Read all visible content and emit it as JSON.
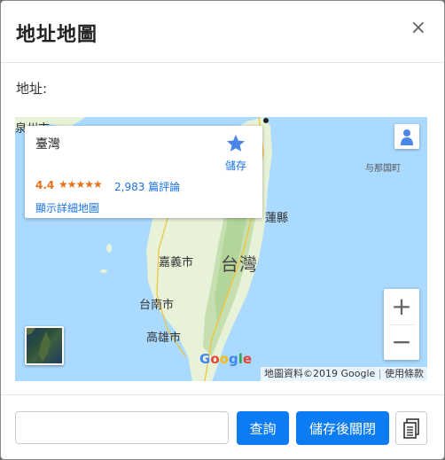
{
  "modal": {
    "title": "地址地圖",
    "close_label": "×",
    "address_label": "地址:"
  },
  "map": {
    "place": {
      "name": "臺灣",
      "save_label": "儲存",
      "rating": "4.4",
      "stars": "★★★★★",
      "reviews": "2,983 篇評論",
      "detail_link": "顯示詳細地圖"
    },
    "labels": {
      "top_left": "泉州市",
      "yonaguni": "与那国町",
      "yilan": "蓮縣",
      "chiayi": "嘉義市",
      "taiwan": "台灣",
      "tainan": "台南市",
      "kaohsiung": "高雄市"
    },
    "zoom_in": "+",
    "zoom_out": "−",
    "google_logo": "Google",
    "attribution": "地圖資料©2019 Google",
    "terms": "使用條款",
    "colors": {
      "water": "#aadaff",
      "land": "#e8f2d8",
      "mountain": "#c6dfb0",
      "accent_blue": "#1a73e8",
      "rating_orange": "#e7711b"
    }
  },
  "footer": {
    "search_value": "",
    "search_button": "查詢",
    "save_close_button": "儲存後關閉",
    "copy_icon": "copy-document-icon",
    "button_color": "#0d7cf2"
  }
}
